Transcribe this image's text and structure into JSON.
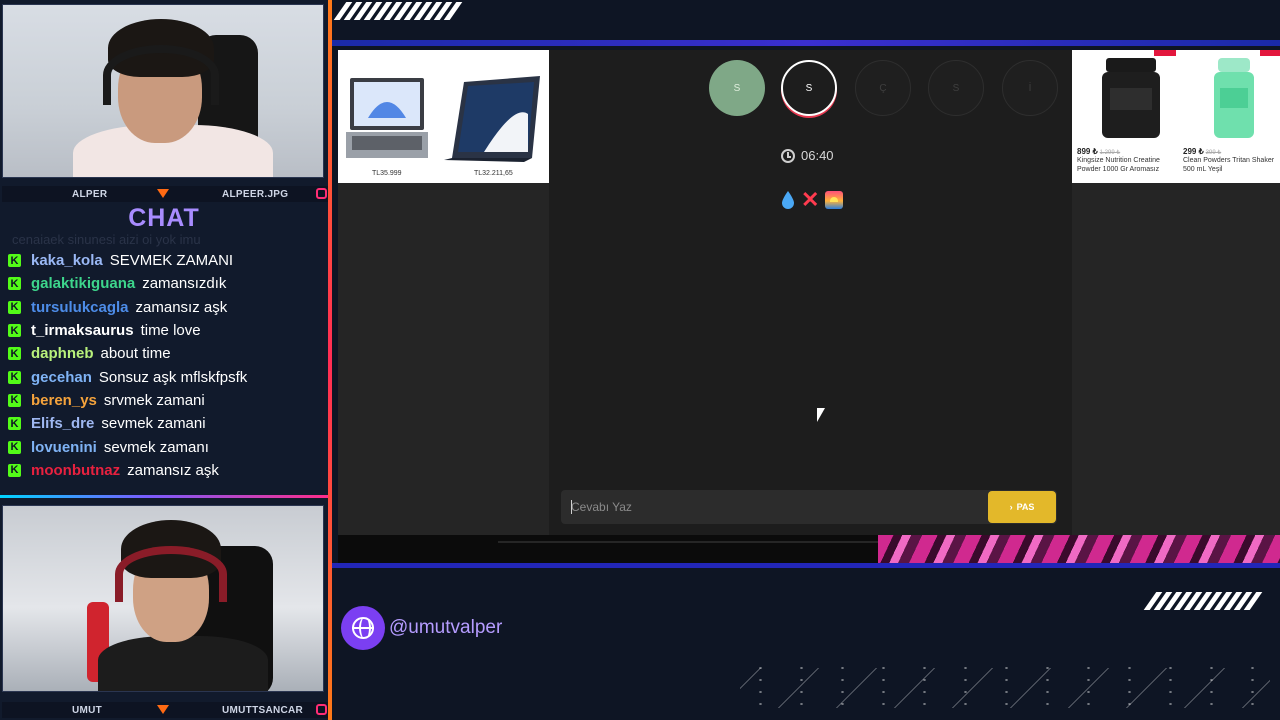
{
  "streamer_top": {
    "left_label": "ALPER",
    "right_label": "ALPEER.JPG"
  },
  "streamer_bottom": {
    "left_label": "UMUT",
    "right_label": "UMUTTSANCAR"
  },
  "chat": {
    "title": "CHAT",
    "ghost_text": "cenaiaek sinunesi aizi oi yok imu",
    "platform_icon": "kick-icon",
    "messages": [
      {
        "user": "kaka_kola",
        "text": "SEVMEK ZAMANI",
        "color": "#9ab8f5"
      },
      {
        "user": "galaktikiguana",
        "text": "zamansızdık",
        "color": "#3dd68c"
      },
      {
        "user": "tursulukcagla",
        "text": "zamansız aşk",
        "color": "#4d8ce8"
      },
      {
        "user": "t_irmaksaurus",
        "text": "time love",
        "color": "#ffffff"
      },
      {
        "user": "daphneb",
        "text": "about time",
        "color": "#b9f27c"
      },
      {
        "user": "gecehan",
        "text": "Sonsuz aşk mflskfpsfk",
        "color": "#7fb3f5"
      },
      {
        "user": "beren_ys",
        "text": "srvmek zamani",
        "color": "#f5a33c"
      },
      {
        "user": "Elifs_dre",
        "text": "sevmek zamani",
        "color": "#9fb8f2"
      },
      {
        "user": "lovuenini",
        "text": "sevmek zamanı",
        "color": "#7fb3f5"
      },
      {
        "user": "moonbutnaz",
        "text": "zamansız aşk",
        "color": "#e8213f"
      }
    ]
  },
  "ads": {
    "laptops": [
      {
        "price": "TL35.999"
      },
      {
        "price": "TL32.211,65"
      }
    ],
    "products": [
      {
        "price": "899 ₺",
        "old_price": "1.299 ₺",
        "name": "Kingsize Nutrition Creatine Powder 1000 Gr Aromasız"
      },
      {
        "price": "299 ₺",
        "old_price": "399 ₺",
        "name": "Clean Powders Tritan Shaker 500 mL Yeşil"
      }
    ]
  },
  "game": {
    "letters": [
      "S",
      "S",
      "Ç",
      "S",
      "İ"
    ],
    "timer": "06:40",
    "hint_icons": [
      "water-drop-icon",
      "cross-icon",
      "sunset-icon"
    ],
    "answer_placeholder": "Cevabı Yaz",
    "pas_label": "PAS"
  },
  "social": {
    "handle": "@umutvalper",
    "icon": "globe-icon"
  },
  "colors": {
    "accent_purple": "#7b3ff2",
    "accent_orange": "#ff6a13",
    "pas_yellow": "#e3b82a",
    "kick_green": "#53fc18"
  }
}
